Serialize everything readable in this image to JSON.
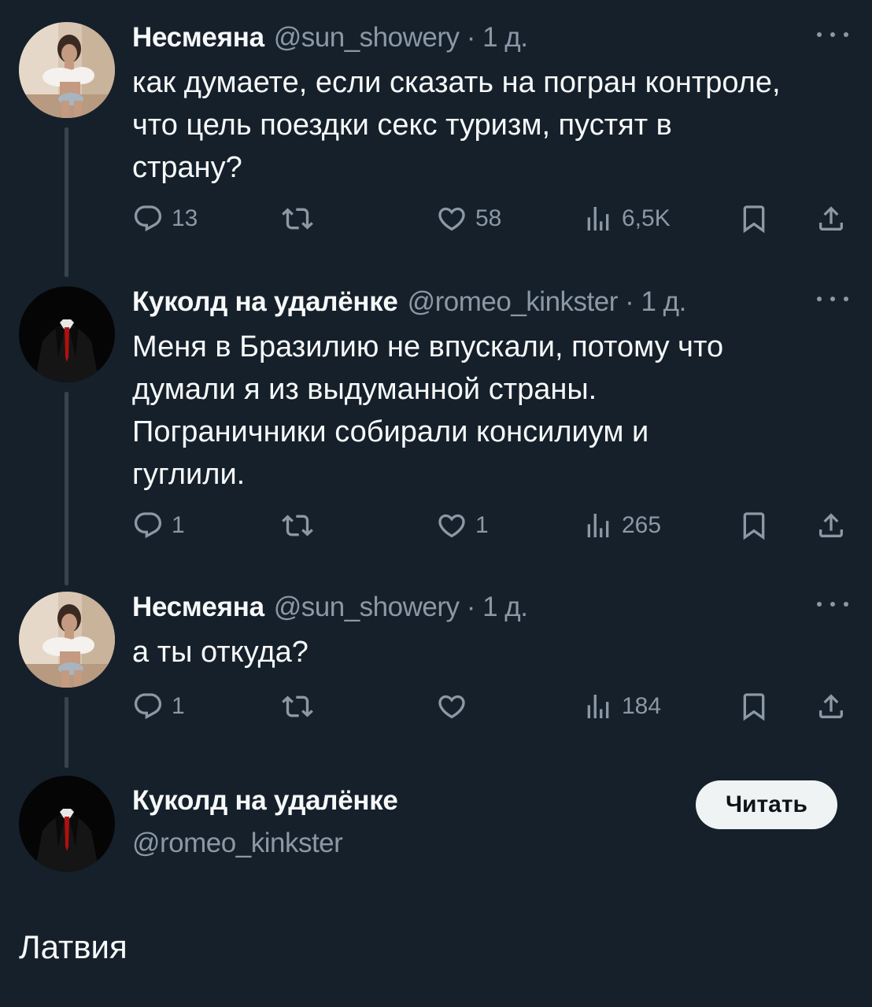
{
  "tweets": [
    {
      "display_name": "Несмеяна",
      "meta": "@sun_showery · 1 д.",
      "text_lines": [
        "как думаете, если сказать на погран контроле,",
        "что цель поездки секс туризм, пустят в",
        "страну?"
      ],
      "replies": "13",
      "retweets": "",
      "likes": "58",
      "views": "6,5K"
    },
    {
      "display_name": "Куколд на удалёнке",
      "meta": "@romeo_kinkster · 1 д.",
      "text_lines": [
        "Меня в Бразилию не впускали, потому что",
        "думали я из выдуманной страны.",
        "Пограничники собирали консилиум и",
        "гуглили."
      ],
      "replies": "1",
      "retweets": "",
      "likes": "1",
      "views": "265"
    },
    {
      "display_name": "Несмеяна",
      "meta": "@sun_showery · 1 д.",
      "text_lines": [
        "а ты откуда?"
      ],
      "replies": "1",
      "retweets": "",
      "likes": "",
      "views": "184"
    }
  ],
  "main_tweet": {
    "display_name": "Куколд на удалёнке",
    "handle": "@romeo_kinkster",
    "follow_label": "Читать",
    "text": "Латвия"
  },
  "icons": {
    "reply": "reply-icon",
    "retweet": "retweet-icon",
    "like": "heart-icon",
    "views": "views-icon",
    "bookmark": "bookmark-icon",
    "share": "share-icon",
    "more": "more-icon"
  },
  "colors": {
    "background": "#15202b",
    "text": "#f7f9f9",
    "secondary": "#8b98a5",
    "thread_line": "#38444d",
    "follow_button": "#eff3f4"
  }
}
